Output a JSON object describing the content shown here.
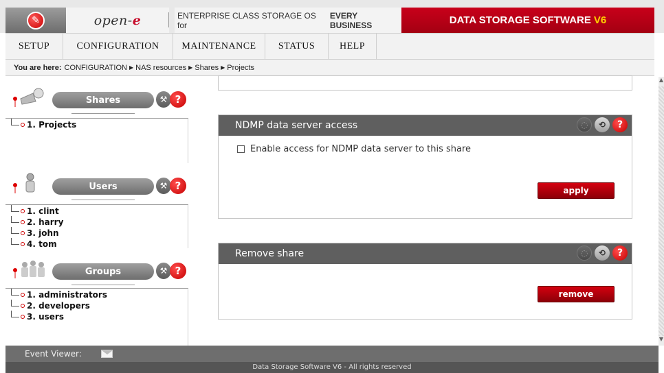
{
  "header": {
    "brand": "open-",
    "brand_e": "e",
    "tagline": "ENTERPRISE CLASS STORAGE OS for",
    "tagline_bold": "EVERY BUSINESS",
    "product": "DATA STORAGE SOFTWARE",
    "product_version": "V6",
    "product_color": "#c8001a"
  },
  "menu": {
    "items": [
      "SETUP",
      "CONFIGURATION",
      "MAINTENANCE",
      "STATUS",
      "HELP"
    ]
  },
  "breadcrumb": {
    "prefix": "You are here:",
    "items": [
      "CONFIGURATION",
      "NAS resources",
      "Shares",
      "Projects"
    ]
  },
  "sidebar": {
    "shares": {
      "title": "Shares",
      "items": [
        "1. Projects"
      ]
    },
    "users": {
      "title": "Users",
      "items": [
        "1. clint",
        "2. harry",
        "3. john",
        "4. tom"
      ]
    },
    "groups": {
      "title": "Groups",
      "items": [
        "1. administrators",
        "2. developers",
        "3. users"
      ]
    }
  },
  "ndmp": {
    "title": "NDMP data server access",
    "checkbox_label": "Enable access for NDMP data server to this share",
    "checked": false,
    "apply": "apply"
  },
  "remove_share": {
    "title": "Remove share",
    "remove": "remove"
  },
  "footer": {
    "event_viewer": "Event Viewer:",
    "copyright": "Data Storage Software V6 - All rights reserved"
  },
  "icons": [
    "wrench-icon",
    "help-icon",
    "refresh-icon",
    "reload-icon",
    "mail-icon"
  ]
}
